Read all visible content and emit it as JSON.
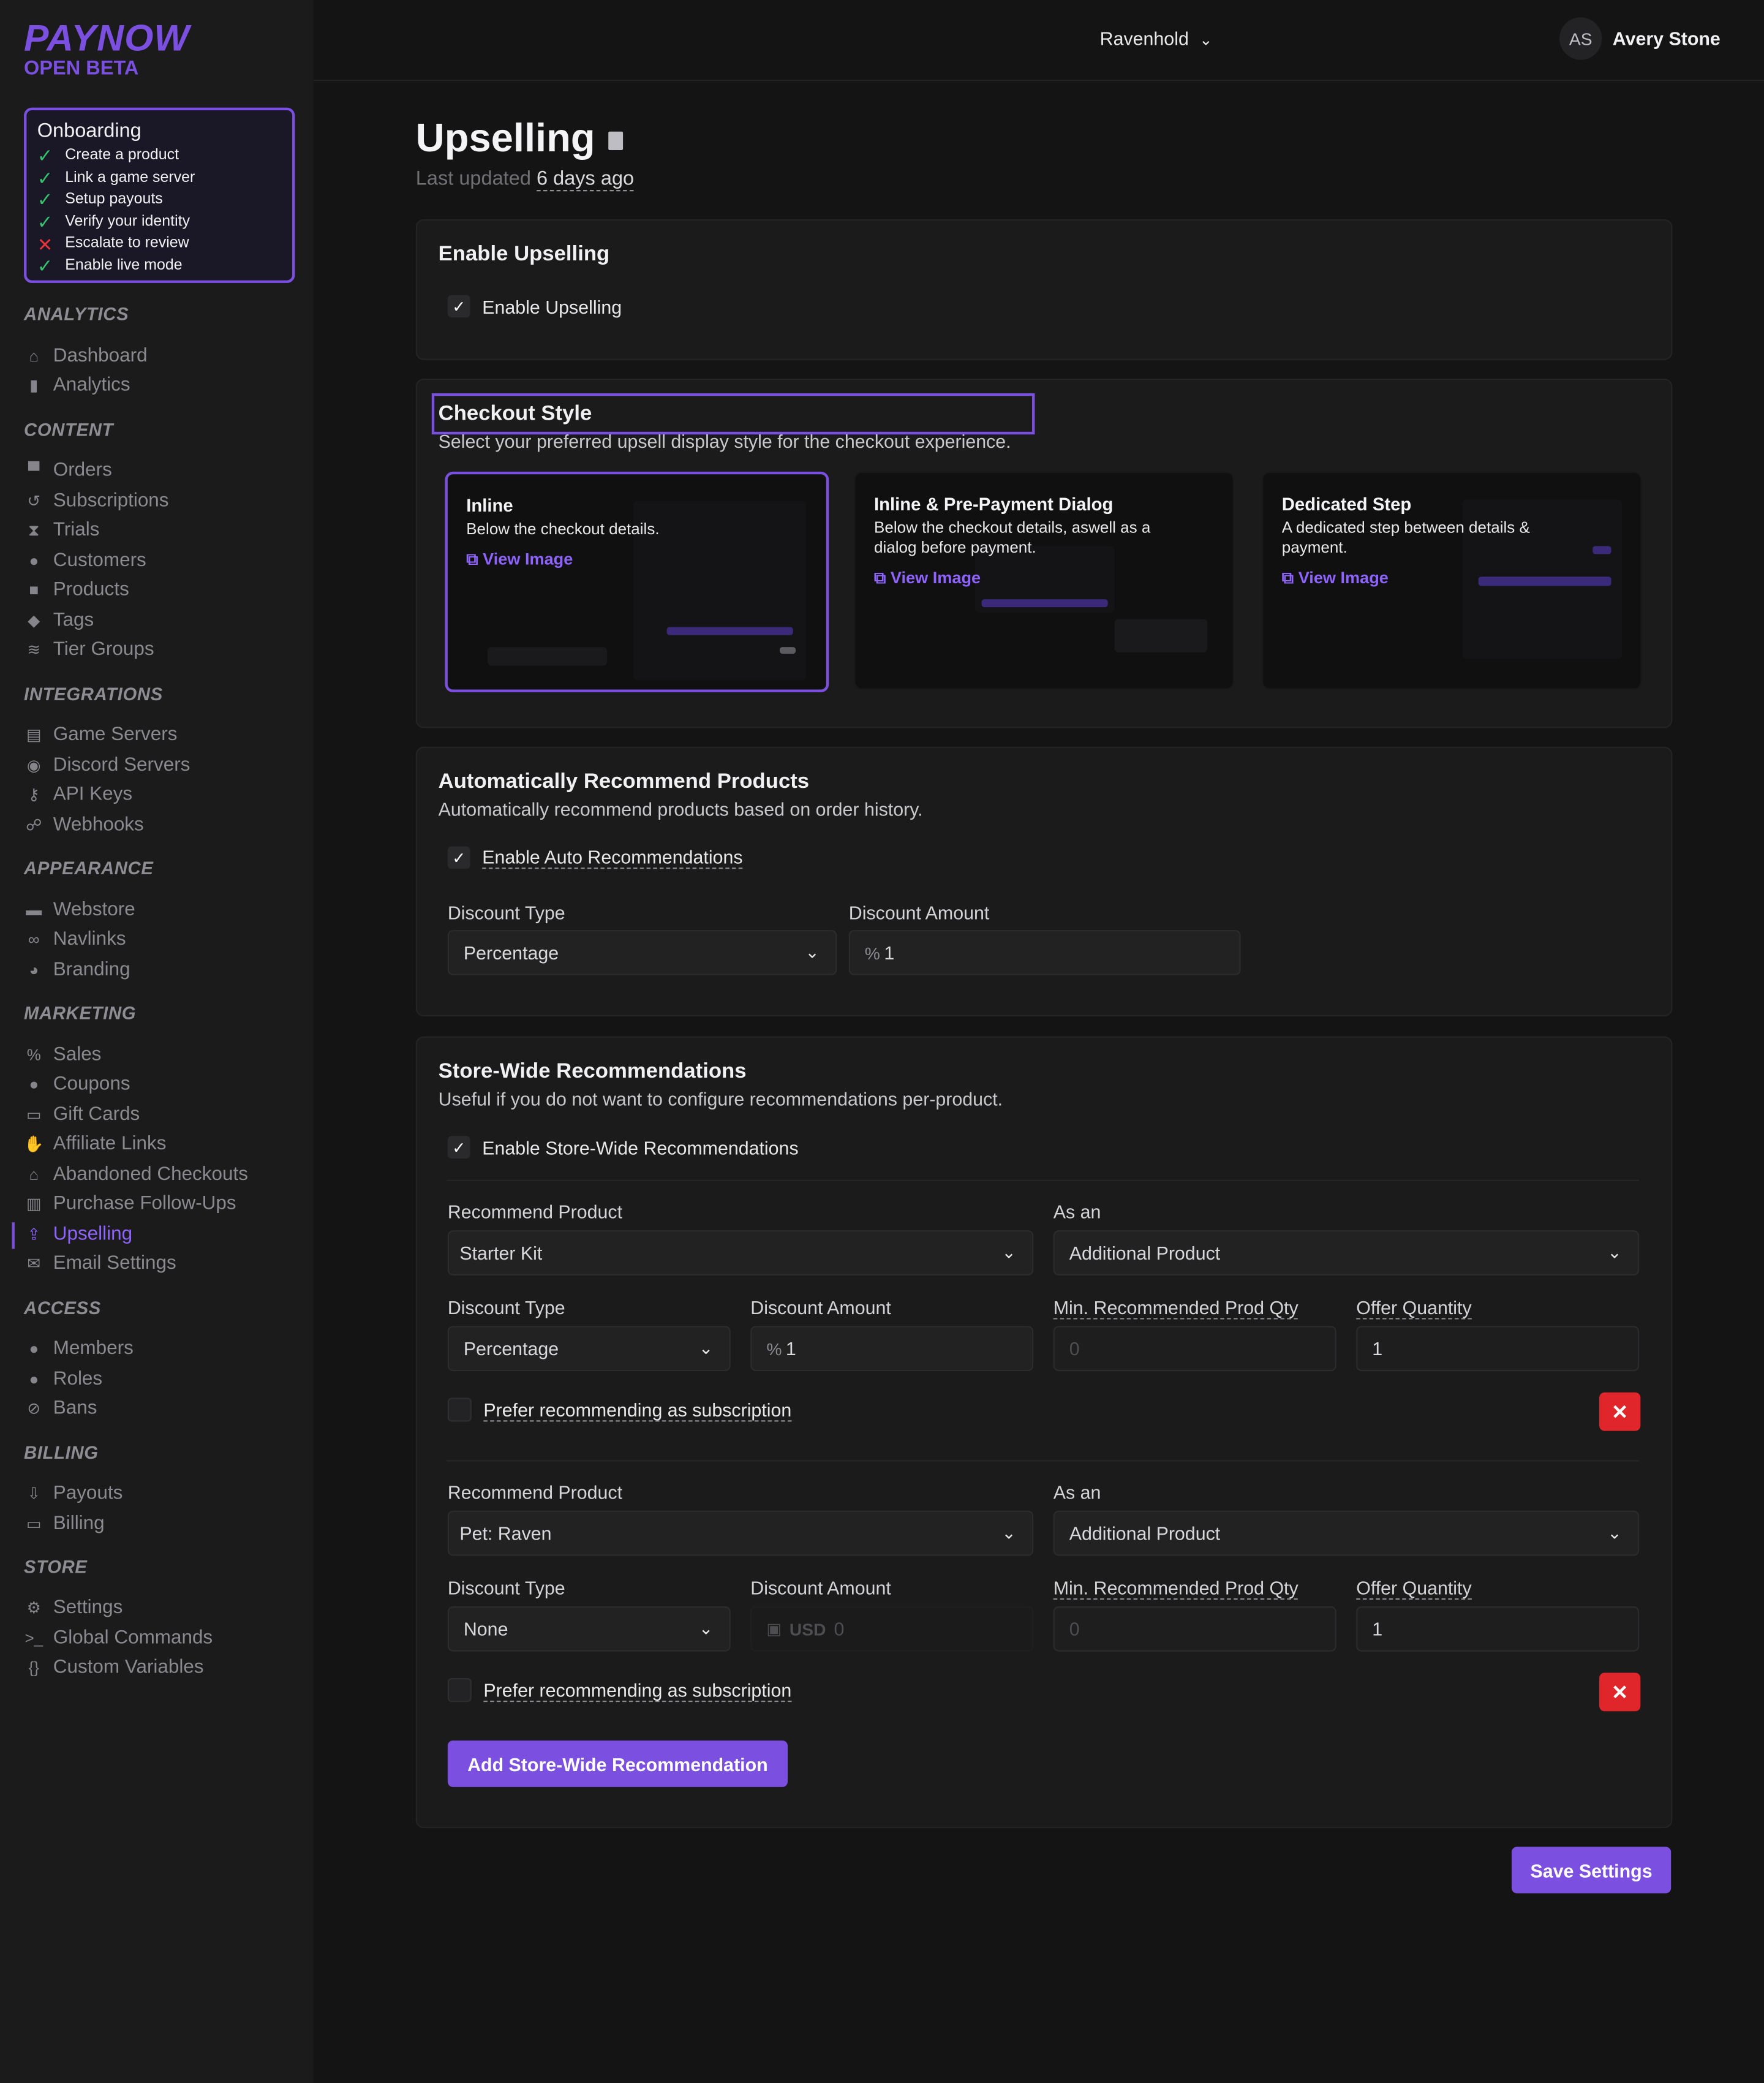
{
  "brand": {
    "name": "PAYNOW",
    "badge": "OPEN BETA"
  },
  "onboarding": {
    "title": "Onboarding",
    "steps": [
      {
        "label": "Create a product",
        "done": true
      },
      {
        "label": "Link a game server",
        "done": true
      },
      {
        "label": "Setup payouts",
        "done": true
      },
      {
        "label": "Verify your identity",
        "done": true
      },
      {
        "label": "Escalate to review",
        "done": false
      },
      {
        "label": "Enable live mode",
        "done": true
      }
    ]
  },
  "sidebar": {
    "analytics": "ANALYTICS",
    "dashboard": "Dashboard",
    "analytics_item": "Analytics",
    "content": "CONTENT",
    "orders": "Orders",
    "subscriptions": "Subscriptions",
    "trials": "Trials",
    "customers": "Customers",
    "products": "Products",
    "tags": "Tags",
    "tier_groups": "Tier Groups",
    "integrations": "INTEGRATIONS",
    "game_servers": "Game Servers",
    "discord_servers": "Discord Servers",
    "api_keys": "API Keys",
    "webhooks": "Webhooks",
    "appearance": "APPEARANCE",
    "webstore": "Webstore",
    "navlinks": "Navlinks",
    "branding": "Branding",
    "marketing": "MARKETING",
    "sales": "Sales",
    "coupons": "Coupons",
    "gift_cards": "Gift Cards",
    "affiliate_links": "Affiliate Links",
    "abandoned": "Abandoned Checkouts",
    "followups": "Purchase Follow-Ups",
    "upselling": "Upselling",
    "email": "Email Settings",
    "access": "ACCESS",
    "members": "Members",
    "roles": "Roles",
    "bans": "Bans",
    "billing": "BILLING",
    "payouts": "Payouts",
    "billing_item": "Billing",
    "store": "STORE",
    "settings": "Settings",
    "global_commands": "Global Commands",
    "custom_variables": "Custom Variables"
  },
  "topbar": {
    "store": "Ravenhold",
    "initials": "AS",
    "user": "Avery Stone"
  },
  "page": {
    "title": "Upselling",
    "updated_prefix": "Last updated",
    "updated_value": "6 days ago"
  },
  "enable": {
    "title": "Enable Upselling",
    "checkbox": "Enable Upselling",
    "checked": true
  },
  "checkout": {
    "title": "Checkout Style",
    "subtitle": "Select your preferred upsell display style for the checkout experience.",
    "view": "View Image",
    "options": [
      {
        "title": "Inline",
        "desc": "Below the checkout details.",
        "selected": true
      },
      {
        "title": "Inline & Pre-Payment Dialog",
        "desc": "Below the checkout details, aswell as a dialog before payment.",
        "selected": false
      },
      {
        "title": "Dedicated Step",
        "desc": "A dedicated step between details & payment.",
        "selected": false
      }
    ]
  },
  "auto": {
    "title": "Automatically Recommend Products",
    "subtitle": "Automatically recommend products based on order history.",
    "checkbox": "Enable Auto Recommendations",
    "discount_type_label": "Discount Type",
    "discount_type": "Percentage",
    "discount_amount_label": "Discount Amount",
    "discount_amount": "1"
  },
  "storewide": {
    "title": "Store-Wide Recommendations",
    "subtitle": "Useful if you do not want to configure recommendations per-product.",
    "checkbox": "Enable Store-Wide Recommendations",
    "labels": {
      "product": "Recommend Product",
      "as_an": "As an",
      "discount_type": "Discount Type",
      "discount_amount": "Discount Amount",
      "min_qty": "Min. Recommended Prod Qty",
      "offer_qty": "Offer Quantity",
      "prefer_sub": "Prefer recommending as subscription"
    },
    "rows": [
      {
        "product": "Starter Kit",
        "as_an": "Additional Product",
        "discount_type": "Percentage",
        "amount_prefix": "%",
        "amount": "1",
        "min_qty": "0",
        "offer_qty": "1"
      },
      {
        "product": "Pet: Raven",
        "as_an": "Additional Product",
        "discount_type": "None",
        "amount_prefix": "USD",
        "amount": "0",
        "min_qty": "0",
        "offer_qty": "1"
      }
    ],
    "add_button": "Add Store-Wide Recommendation"
  },
  "save_button": "Save Settings",
  "colors": {
    "accent": "#7b4fe0",
    "danger": "#e0262b",
    "success": "#36c26b"
  }
}
